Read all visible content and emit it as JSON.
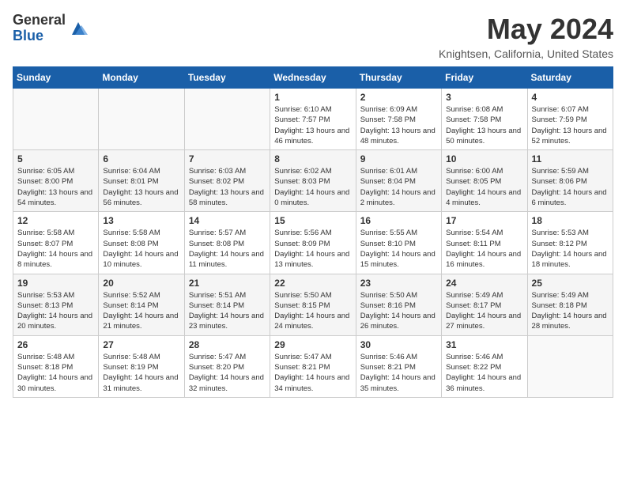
{
  "logo": {
    "general": "General",
    "blue": "Blue"
  },
  "title": "May 2024",
  "location": "Knightsen, California, United States",
  "days_of_week": [
    "Sunday",
    "Monday",
    "Tuesday",
    "Wednesday",
    "Thursday",
    "Friday",
    "Saturday"
  ],
  "weeks": [
    [
      {
        "day": "",
        "info": ""
      },
      {
        "day": "",
        "info": ""
      },
      {
        "day": "",
        "info": ""
      },
      {
        "day": "1",
        "info": "Sunrise: 6:10 AM\nSunset: 7:57 PM\nDaylight: 13 hours and 46 minutes."
      },
      {
        "day": "2",
        "info": "Sunrise: 6:09 AM\nSunset: 7:58 PM\nDaylight: 13 hours and 48 minutes."
      },
      {
        "day": "3",
        "info": "Sunrise: 6:08 AM\nSunset: 7:58 PM\nDaylight: 13 hours and 50 minutes."
      },
      {
        "day": "4",
        "info": "Sunrise: 6:07 AM\nSunset: 7:59 PM\nDaylight: 13 hours and 52 minutes."
      }
    ],
    [
      {
        "day": "5",
        "info": "Sunrise: 6:05 AM\nSunset: 8:00 PM\nDaylight: 13 hours and 54 minutes."
      },
      {
        "day": "6",
        "info": "Sunrise: 6:04 AM\nSunset: 8:01 PM\nDaylight: 13 hours and 56 minutes."
      },
      {
        "day": "7",
        "info": "Sunrise: 6:03 AM\nSunset: 8:02 PM\nDaylight: 13 hours and 58 minutes."
      },
      {
        "day": "8",
        "info": "Sunrise: 6:02 AM\nSunset: 8:03 PM\nDaylight: 14 hours and 0 minutes."
      },
      {
        "day": "9",
        "info": "Sunrise: 6:01 AM\nSunset: 8:04 PM\nDaylight: 14 hours and 2 minutes."
      },
      {
        "day": "10",
        "info": "Sunrise: 6:00 AM\nSunset: 8:05 PM\nDaylight: 14 hours and 4 minutes."
      },
      {
        "day": "11",
        "info": "Sunrise: 5:59 AM\nSunset: 8:06 PM\nDaylight: 14 hours and 6 minutes."
      }
    ],
    [
      {
        "day": "12",
        "info": "Sunrise: 5:58 AM\nSunset: 8:07 PM\nDaylight: 14 hours and 8 minutes."
      },
      {
        "day": "13",
        "info": "Sunrise: 5:58 AM\nSunset: 8:08 PM\nDaylight: 14 hours and 10 minutes."
      },
      {
        "day": "14",
        "info": "Sunrise: 5:57 AM\nSunset: 8:08 PM\nDaylight: 14 hours and 11 minutes."
      },
      {
        "day": "15",
        "info": "Sunrise: 5:56 AM\nSunset: 8:09 PM\nDaylight: 14 hours and 13 minutes."
      },
      {
        "day": "16",
        "info": "Sunrise: 5:55 AM\nSunset: 8:10 PM\nDaylight: 14 hours and 15 minutes."
      },
      {
        "day": "17",
        "info": "Sunrise: 5:54 AM\nSunset: 8:11 PM\nDaylight: 14 hours and 16 minutes."
      },
      {
        "day": "18",
        "info": "Sunrise: 5:53 AM\nSunset: 8:12 PM\nDaylight: 14 hours and 18 minutes."
      }
    ],
    [
      {
        "day": "19",
        "info": "Sunrise: 5:53 AM\nSunset: 8:13 PM\nDaylight: 14 hours and 20 minutes."
      },
      {
        "day": "20",
        "info": "Sunrise: 5:52 AM\nSunset: 8:14 PM\nDaylight: 14 hours and 21 minutes."
      },
      {
        "day": "21",
        "info": "Sunrise: 5:51 AM\nSunset: 8:14 PM\nDaylight: 14 hours and 23 minutes."
      },
      {
        "day": "22",
        "info": "Sunrise: 5:50 AM\nSunset: 8:15 PM\nDaylight: 14 hours and 24 minutes."
      },
      {
        "day": "23",
        "info": "Sunrise: 5:50 AM\nSunset: 8:16 PM\nDaylight: 14 hours and 26 minutes."
      },
      {
        "day": "24",
        "info": "Sunrise: 5:49 AM\nSunset: 8:17 PM\nDaylight: 14 hours and 27 minutes."
      },
      {
        "day": "25",
        "info": "Sunrise: 5:49 AM\nSunset: 8:18 PM\nDaylight: 14 hours and 28 minutes."
      }
    ],
    [
      {
        "day": "26",
        "info": "Sunrise: 5:48 AM\nSunset: 8:18 PM\nDaylight: 14 hours and 30 minutes."
      },
      {
        "day": "27",
        "info": "Sunrise: 5:48 AM\nSunset: 8:19 PM\nDaylight: 14 hours and 31 minutes."
      },
      {
        "day": "28",
        "info": "Sunrise: 5:47 AM\nSunset: 8:20 PM\nDaylight: 14 hours and 32 minutes."
      },
      {
        "day": "29",
        "info": "Sunrise: 5:47 AM\nSunset: 8:21 PM\nDaylight: 14 hours and 34 minutes."
      },
      {
        "day": "30",
        "info": "Sunrise: 5:46 AM\nSunset: 8:21 PM\nDaylight: 14 hours and 35 minutes."
      },
      {
        "day": "31",
        "info": "Sunrise: 5:46 AM\nSunset: 8:22 PM\nDaylight: 14 hours and 36 minutes."
      },
      {
        "day": "",
        "info": ""
      }
    ]
  ]
}
